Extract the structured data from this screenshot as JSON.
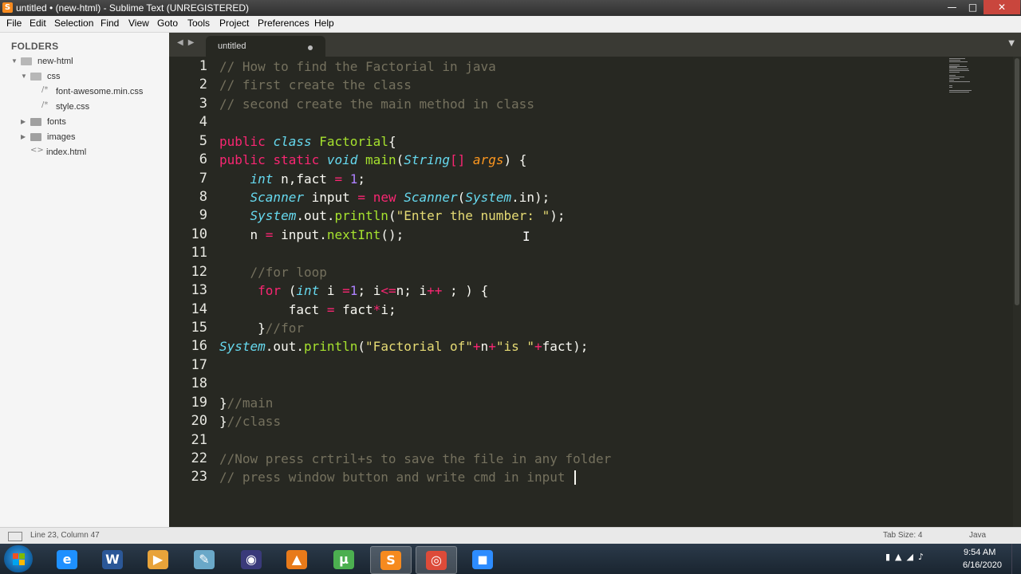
{
  "window": {
    "title": "untitled • (new-html) - Sublime Text (UNREGISTERED)",
    "controls": {
      "minimize": "—",
      "maximize": "□",
      "close": "✕"
    }
  },
  "menu": [
    "File",
    "Edit",
    "Selection",
    "Find",
    "View",
    "Goto",
    "Tools",
    "Project",
    "Preferences",
    "Help"
  ],
  "sidebar": {
    "title": "FOLDERS",
    "tree": [
      {
        "label": "new-html",
        "kind": "folder-open",
        "depth": 0
      },
      {
        "label": "css",
        "kind": "folder-open",
        "depth": 1
      },
      {
        "label": "font-awesome.min.css",
        "kind": "file",
        "depth": 2
      },
      {
        "label": "style.css",
        "kind": "file",
        "depth": 2
      },
      {
        "label": "fonts",
        "kind": "folder",
        "depth": 1
      },
      {
        "label": "images",
        "kind": "folder",
        "depth": 1
      },
      {
        "label": "index.html",
        "kind": "file-html",
        "depth": 1
      }
    ]
  },
  "tab": {
    "label": "untitled",
    "dirty": true
  },
  "editor": {
    "lines": [
      [
        [
          "cm",
          "// How to find the Factorial in java"
        ]
      ],
      [
        [
          "cm",
          "// first create the class"
        ]
      ],
      [
        [
          "cm",
          "// second create the main method in class"
        ]
      ],
      [],
      [
        [
          "kw",
          "public"
        ],
        [
          "pl",
          " "
        ],
        [
          "st",
          "class"
        ],
        [
          "pl",
          " "
        ],
        [
          "cl",
          "Factorial"
        ],
        [
          "pl",
          "{"
        ]
      ],
      [
        [
          "kw",
          "public"
        ],
        [
          "pl",
          " "
        ],
        [
          "kw",
          "static"
        ],
        [
          "pl",
          " "
        ],
        [
          "st",
          "void"
        ],
        [
          "pl",
          " "
        ],
        [
          "fn",
          "main"
        ],
        [
          "pl",
          "("
        ],
        [
          "tp",
          "String"
        ],
        [
          "kw",
          "[]"
        ],
        [
          "pl",
          " "
        ],
        [
          "arg",
          "args"
        ],
        [
          "pl",
          ") {"
        ]
      ],
      [
        [
          "pl",
          "    "
        ],
        [
          "st",
          "int"
        ],
        [
          "pl",
          " n,fact "
        ],
        [
          "kw",
          "="
        ],
        [
          "pl",
          " "
        ],
        [
          "nm",
          "1"
        ],
        [
          "pl",
          ";"
        ]
      ],
      [
        [
          "pl",
          "    "
        ],
        [
          "tp",
          "Scanner"
        ],
        [
          "pl",
          " input "
        ],
        [
          "kw",
          "="
        ],
        [
          "pl",
          " "
        ],
        [
          "kw",
          "new"
        ],
        [
          "pl",
          " "
        ],
        [
          "tp",
          "Scanner"
        ],
        [
          "pl",
          "("
        ],
        [
          "tp",
          "System"
        ],
        [
          "pl",
          ".in);"
        ]
      ],
      [
        [
          "pl",
          "    "
        ],
        [
          "tp",
          "System"
        ],
        [
          "pl",
          ".out."
        ],
        [
          "fn",
          "println"
        ],
        [
          "pl",
          "("
        ],
        [
          "str",
          "\"Enter the number: \""
        ],
        [
          "pl",
          ");"
        ]
      ],
      [
        [
          "pl",
          "    n "
        ],
        [
          "kw",
          "="
        ],
        [
          "pl",
          " input."
        ],
        [
          "fn",
          "nextInt"
        ],
        [
          "pl",
          "();"
        ]
      ],
      [],
      [
        [
          "pl",
          "    "
        ],
        [
          "cm",
          "//for loop"
        ]
      ],
      [
        [
          "pl",
          "     "
        ],
        [
          "kw",
          "for"
        ],
        [
          "pl",
          " ("
        ],
        [
          "st",
          "int"
        ],
        [
          "pl",
          " i "
        ],
        [
          "kw",
          "="
        ],
        [
          "nm",
          "1"
        ],
        [
          "pl",
          "; i"
        ],
        [
          "kw",
          "<="
        ],
        [
          "pl",
          "n; i"
        ],
        [
          "kw",
          "++"
        ],
        [
          "pl",
          " ; ) {"
        ]
      ],
      [
        [
          "pl",
          "         fact "
        ],
        [
          "kw",
          "="
        ],
        [
          "pl",
          " fact"
        ],
        [
          "kw",
          "*"
        ],
        [
          "pl",
          "i;"
        ]
      ],
      [
        [
          "pl",
          "     }"
        ],
        [
          "cm",
          "//for"
        ]
      ],
      [
        [
          "tp",
          "System"
        ],
        [
          "pl",
          ".out."
        ],
        [
          "fn",
          "println"
        ],
        [
          "pl",
          "("
        ],
        [
          "str",
          "\"Factorial of\""
        ],
        [
          "kw",
          "+"
        ],
        [
          "pl",
          "n"
        ],
        [
          "kw",
          "+"
        ],
        [
          "str",
          "\"is \""
        ],
        [
          "kw",
          "+"
        ],
        [
          "pl",
          "fact);"
        ]
      ],
      [],
      [],
      [
        [
          "pl",
          "}"
        ],
        [
          "cm",
          "//main"
        ]
      ],
      [
        [
          "pl",
          "}"
        ],
        [
          "cm",
          "//class"
        ]
      ],
      [],
      [
        [
          "cm",
          "//Now press crtril+s to save the file in any folder"
        ]
      ],
      [
        [
          "cm",
          "// press window button and write cmd in input "
        ]
      ]
    ]
  },
  "status": {
    "position": "Line 23, Column 47",
    "tab_size": "Tab Size: 4",
    "syntax": "Java"
  },
  "taskbar": {
    "apps": [
      {
        "name": "internet-explorer",
        "glyph": "e",
        "color": "#1e90ff"
      },
      {
        "name": "word",
        "glyph": "W",
        "color": "#2b5797"
      },
      {
        "name": "media-player",
        "glyph": "▶",
        "color": "#e8a33a"
      },
      {
        "name": "notepad",
        "glyph": "✎",
        "color": "#6aa8c8"
      },
      {
        "name": "eclipse",
        "glyph": "◉",
        "color": "#3a3a7a"
      },
      {
        "name": "vlc",
        "glyph": "▲",
        "color": "#e87a1a"
      },
      {
        "name": "utorrent",
        "glyph": "µ",
        "color": "#4caf50"
      },
      {
        "name": "sublime-text",
        "glyph": "S",
        "color": "#f68a1f"
      },
      {
        "name": "chrome",
        "glyph": "◎",
        "color": "#dd4b39"
      },
      {
        "name": "zoom",
        "glyph": "◼",
        "color": "#2d8cff"
      }
    ],
    "time": "9:54 AM",
    "date": "6/16/2020"
  }
}
